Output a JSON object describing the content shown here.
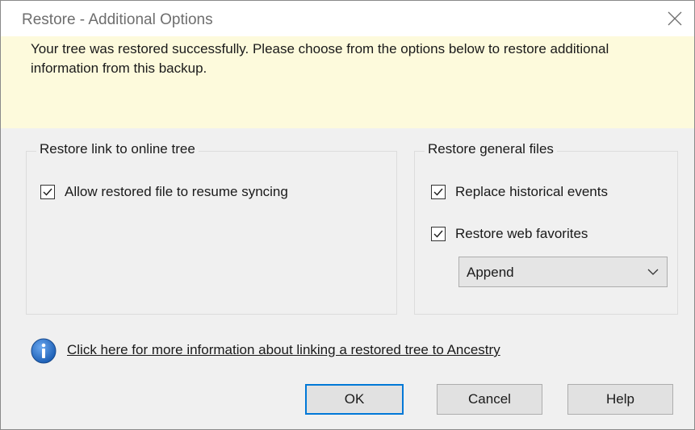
{
  "window": {
    "title": "Restore - Additional Options"
  },
  "banner": {
    "message": "Your tree was restored successfully.  Please choose from the options below to restore additional information from this backup."
  },
  "online_group": {
    "legend": "Restore link to online tree",
    "resume_sync": {
      "label": "Allow restored file to resume syncing",
      "checked": true
    }
  },
  "files_group": {
    "legend": "Restore general files",
    "historical_events": {
      "label": "Replace historical events",
      "checked": true
    },
    "web_favorites": {
      "label": "Restore web favorites",
      "checked": true
    },
    "favorites_mode": {
      "value": "Append"
    }
  },
  "info": {
    "link_text": "Click here for more information about linking a restored tree to Ancestry"
  },
  "buttons": {
    "ok": "OK",
    "cancel": "Cancel",
    "help": "Help"
  },
  "colors": {
    "banner_bg": "#fdfadc",
    "focus_border": "#0078d7",
    "info_icon": "#1c5fb5"
  }
}
